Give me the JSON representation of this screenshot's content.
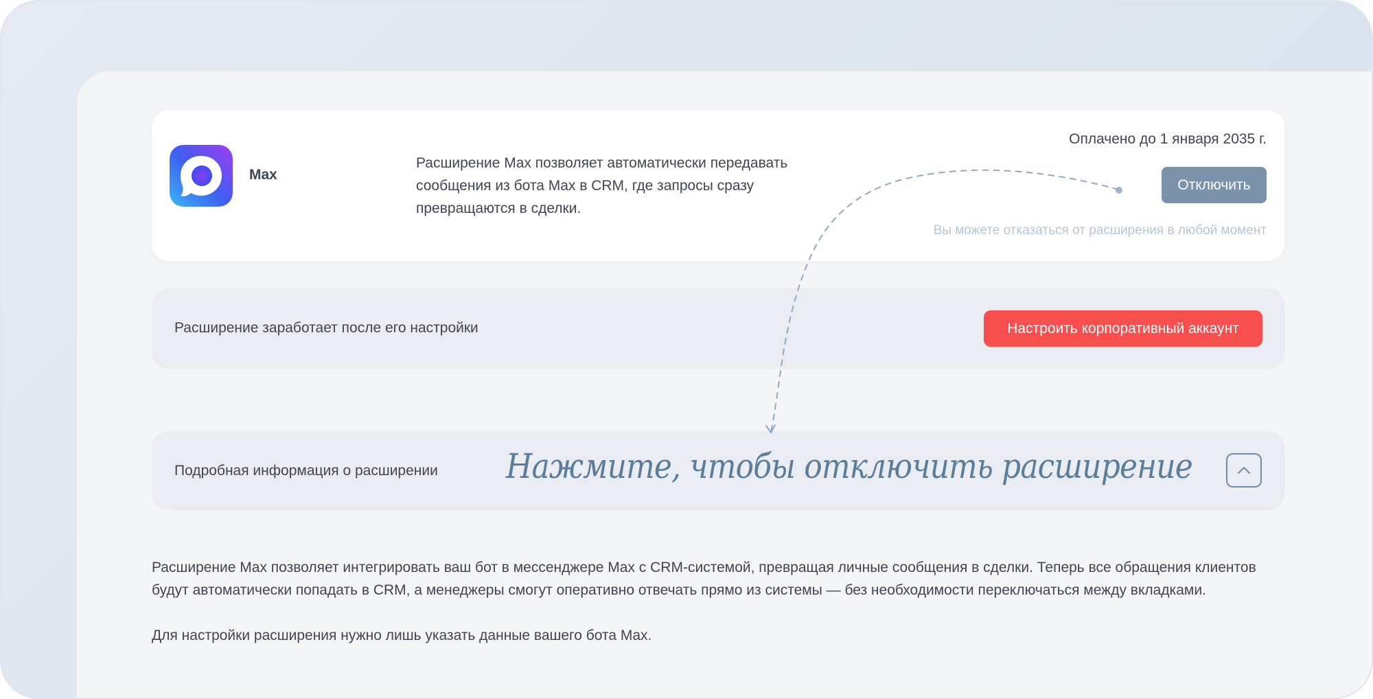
{
  "extension": {
    "name": "Max",
    "description": "Расширение Max позволяет автоматически передавать сообщения из бота Max в CRM, где запросы сразу превращаются в сделки.",
    "paid_until": "Оплачено до 1 января 2035 г.",
    "disable_label": "Отключить",
    "cancel_note": "Вы можете отказаться от расширения в любой момент",
    "icon": "max-logo-icon"
  },
  "setup": {
    "text": "Расширение заработает после его настройки",
    "button_label": "Настроить корпоративный аккаунт"
  },
  "details": {
    "title": "Подробная информация о расширении",
    "toggle_icon": "chevron-up-icon",
    "paragraphs": [
      "Расширение Max позволяет интегрировать ваш бот в мессенджере Max с CRM-системой, превращая личные сообщения в сделки. Теперь все обращения клиентов будут автоматически попадать в CRM, а менеджеры смогут оперативно отвечать прямо из системы — без необходимости переключаться между вкладками.",
      "Для настройки расширения нужно лишь указать данные вашего бота Max."
    ]
  },
  "annotation": {
    "text": "Нажмите, чтобы отключить расширение"
  },
  "colors": {
    "disable_button": "#7a93ab",
    "setup_button": "#f84e4e",
    "annotation": "#5c7d99"
  }
}
